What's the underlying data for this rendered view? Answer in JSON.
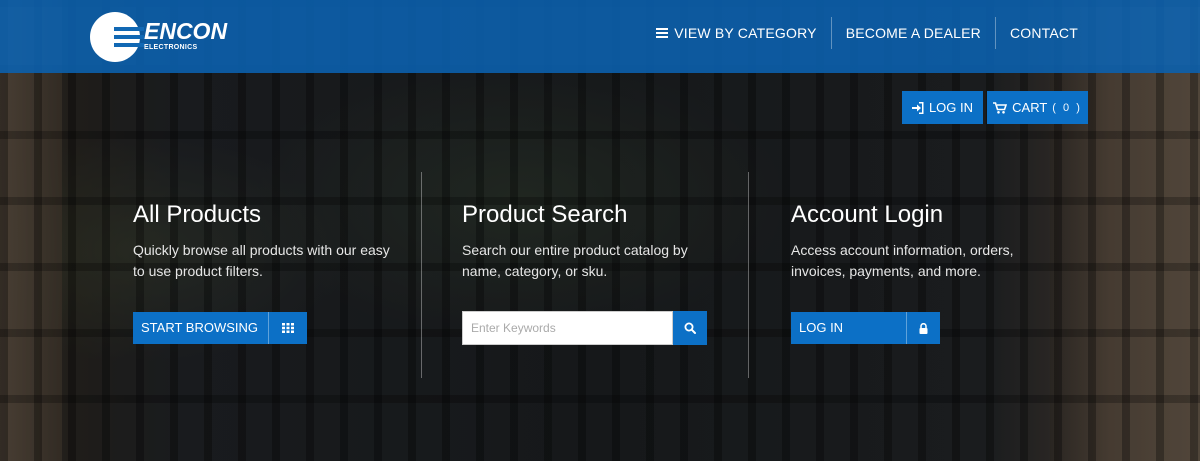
{
  "brand": {
    "name": "ENCON",
    "sub": "ELECTRONICS"
  },
  "nav": {
    "view_by_category": "VIEW BY CATEGORY",
    "become_dealer": "BECOME A DEALER",
    "contact": "CONTACT"
  },
  "account": {
    "login_label": "LOG IN",
    "cart_label": "CART",
    "cart_count": "( 0 )"
  },
  "columns": {
    "all_products": {
      "title": "All Products",
      "description": "Quickly browse all products with our easy to use product filters.",
      "button": "START BROWSING"
    },
    "product_search": {
      "title": "Product Search",
      "description": "Search our entire product catalog by name, category, or sku.",
      "placeholder": "Enter Keywords"
    },
    "account_login": {
      "title": "Account Login",
      "description": "Access account information, orders, invoices, payments, and more.",
      "button": "LOG IN"
    }
  },
  "colors": {
    "header": "#0c64b4",
    "button": "#0c70c6"
  },
  "icons": [
    "menu-icon",
    "sign-in-icon",
    "cart-icon",
    "grid-icon",
    "search-icon",
    "lock-icon"
  ]
}
